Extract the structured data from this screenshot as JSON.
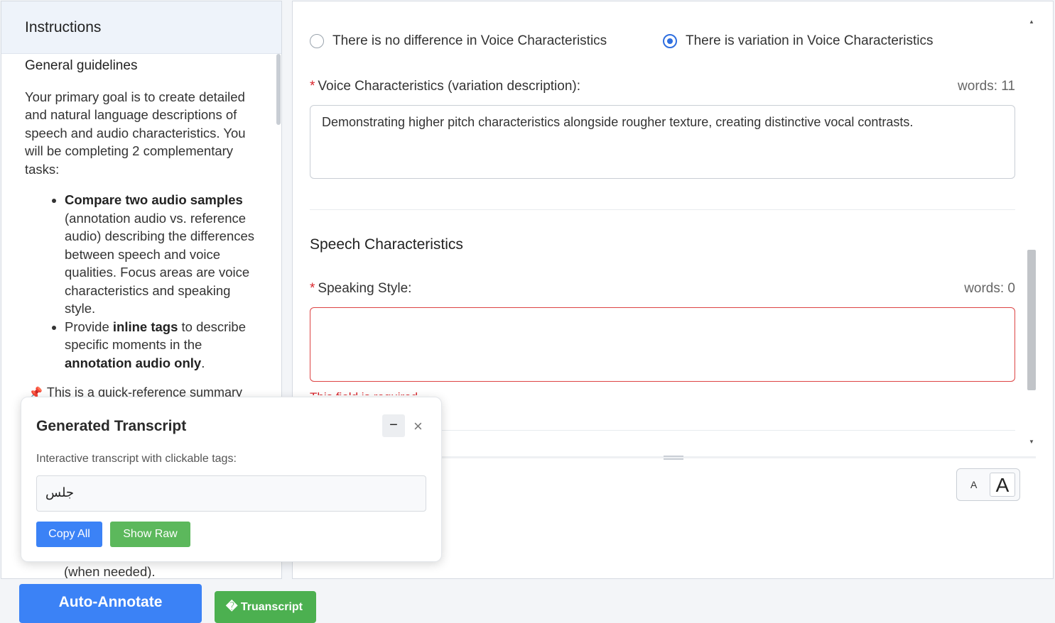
{
  "instructions": {
    "header": "Instructions",
    "subheading": "General guidelines",
    "intro": "Your primary goal is to create detailed and natural language descriptions of speech and audio characteristics. You will be completing 2 complementary tasks:",
    "bullet1_bold": "Compare two audio samples",
    "bullet1_rest": " (annotation audio vs. reference audio) describing the differences between speech and voice qualities. Focus areas are voice characteristics and speaking style.",
    "bullet2_pre": "Provide ",
    "bullet2_bold": "inline tags",
    "bullet2_mid": " to describe specific moments in the ",
    "bullet2_bold2": "annotation audio only",
    "bullet2_end": ".",
    "note": "This is a quick-reference summary",
    "note_icon": "pushpin-icon",
    "tail": "(when needed)."
  },
  "form": {
    "radio_no_diff": "There is no difference in Voice Characteristics",
    "radio_variation": "There is variation in Voice Characteristics",
    "voice_label": "Voice Characteristics (variation description):",
    "voice_required": "*",
    "voice_words": "words: 11",
    "voice_value": "Demonstrating higher pitch characteristics alongside rougher texture, creating distinctive vocal contrasts.",
    "speech_section": "Speech Characteristics",
    "style_label": "Speaking Style:",
    "style_required": "*",
    "style_words": "words: 0",
    "style_value": "",
    "style_error": "This field is required",
    "font_small": "A",
    "font_large": "A"
  },
  "popup": {
    "title": "Generated Transcript",
    "minimize": "−",
    "close": "×",
    "subtitle": "Interactive transcript with clickable tags:",
    "transcript": "جلس",
    "copy_label": "Copy All",
    "raw_label": "Show Raw"
  },
  "actions": {
    "auto_annotate": "Auto-Annotate",
    "truanscript": "Truanscript",
    "truanscript_icon": "�"
  },
  "colors": {
    "primary": "#3b82f6",
    "success": "#5cb85c",
    "error": "#d9262c"
  }
}
